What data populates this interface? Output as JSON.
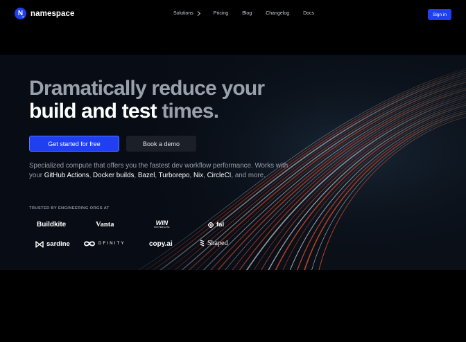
{
  "nav": {
    "logo_mark": "N",
    "logo_text": "namespace",
    "links": [
      {
        "label": "Solutions",
        "has_dropdown": true
      },
      {
        "label": "Pricing"
      },
      {
        "label": "Blog"
      },
      {
        "label": "Changelog"
      },
      {
        "label": "Docs"
      }
    ],
    "signin_label": "Sign in"
  },
  "hero": {
    "headline_line1": "Dramatically reduce your",
    "headline_line2_bright": "build and test",
    "headline_line2_dim": "times.",
    "cta_primary": "Get started for free",
    "cta_secondary": "Book a demo",
    "subcopy": {
      "intro": "Specialized compute that offers you the fastest dev workflow performance. Works with your ",
      "tools": [
        "GitHub Actions",
        "Docker builds",
        "Bazel",
        "Turborepo",
        "Nix",
        "CircleCI"
      ],
      "outro": ", and more."
    },
    "trusted_label": "TRUSTED BY ENGINEERING ORGS AT",
    "brands": {
      "buildkite": "Buildkite",
      "vanta": "Vanta",
      "win": "WIN",
      "win_sub": "WINTERGATE",
      "fal": "fal",
      "sardine": "sardine",
      "dfinity": "DFINITY",
      "copyai": "copy.ai",
      "shaped": "Shaped"
    }
  },
  "colors": {
    "accent": "#1f3ff0",
    "background": "#000000",
    "hero_bg": "#07090f",
    "text_dim": "#9aa0ab",
    "text_bright": "#ffffff"
  }
}
